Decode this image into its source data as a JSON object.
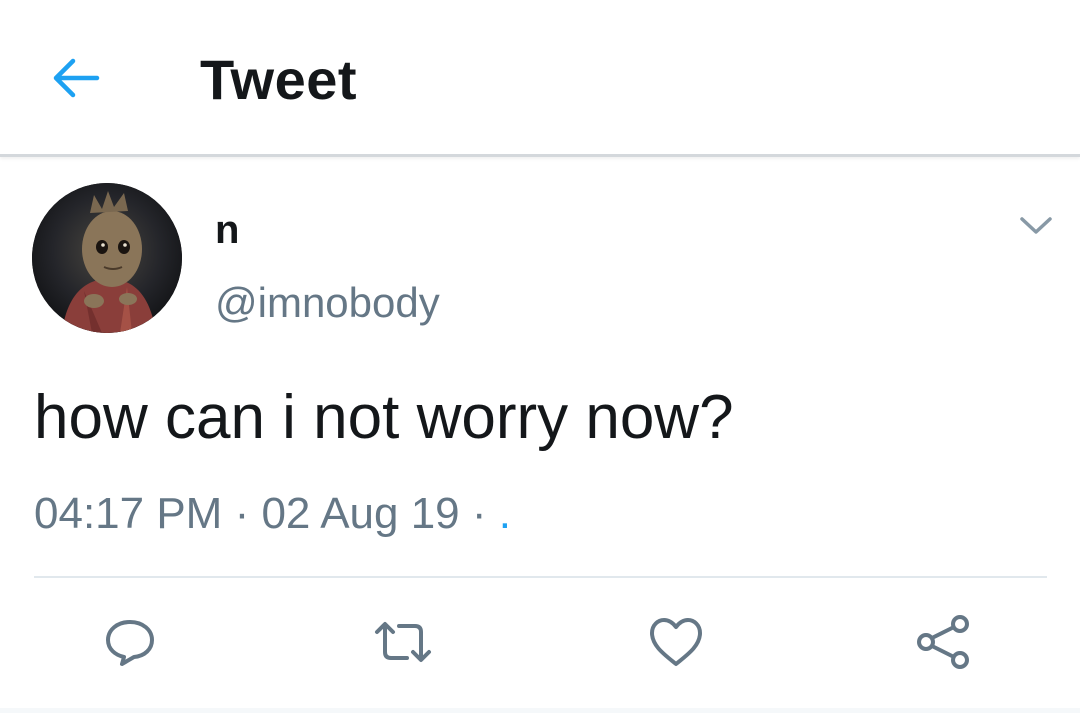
{
  "header": {
    "back_icon": "arrow-left-icon",
    "title": "Tweet"
  },
  "tweet": {
    "author": {
      "display_name": "n",
      "handle": "@imnobody",
      "avatar": "groot-avatar"
    },
    "text": "how can i not worry now?",
    "time": "04:17 PM",
    "separator1": " · ",
    "date": "02 Aug 19",
    "separator2": " · ",
    "source": ".",
    "more_icon": "chevron-down-icon"
  },
  "actions": [
    {
      "icon": "reply-icon"
    },
    {
      "icon": "retweet-icon"
    },
    {
      "icon": "like-icon"
    },
    {
      "icon": "share-icon"
    }
  ],
  "colors": {
    "accent": "#1da1f2",
    "text_primary": "#14171a",
    "text_secondary": "#657786",
    "icon_gray": "#657786"
  }
}
